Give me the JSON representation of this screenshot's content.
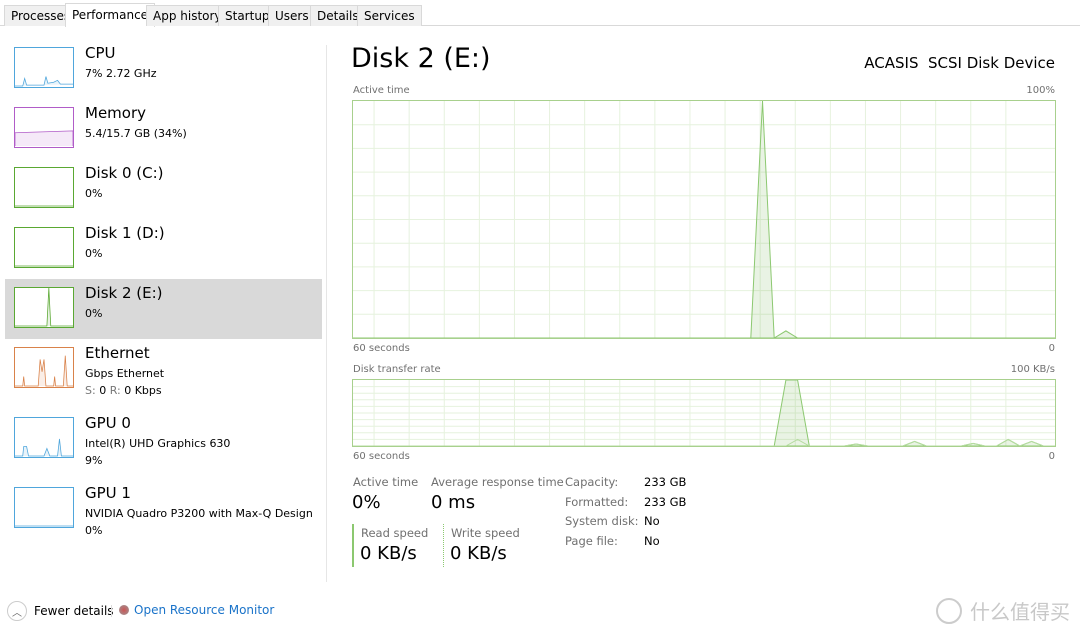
{
  "tabs": [
    "Processes",
    "Performance",
    "App history",
    "Startup",
    "Users",
    "Details",
    "Services"
  ],
  "active_tab": "Performance",
  "sidebar": [
    {
      "title": "CPU",
      "lines": [
        "7%  2.72 GHz"
      ],
      "color": "#4fa6dc"
    },
    {
      "title": "Memory",
      "lines": [
        "5.4/15.7 GB (34%)"
      ],
      "color": "#b15cc8"
    },
    {
      "title": "Disk 0 (C:)",
      "lines": [
        "0%"
      ],
      "color": "#5aa832"
    },
    {
      "title": "Disk 1 (D:)",
      "lines": [
        "0%"
      ],
      "color": "#5aa832"
    },
    {
      "title": "Disk 2 (E:)",
      "lines": [
        "0%"
      ],
      "color": "#5aa832",
      "selected": true
    },
    {
      "title": "Ethernet",
      "lines": [
        "Gbps Ethernet"
      ],
      "send_label": "S:",
      "send": "0",
      "recv_label": "R:",
      "recv": "0 Kbps",
      "color": "#d9824a"
    },
    {
      "title": "GPU 0",
      "lines": [
        "Intel(R) UHD Graphics 630",
        "9%"
      ],
      "color": "#4fa6dc"
    },
    {
      "title": "GPU 1",
      "lines": [
        "NVIDIA Quadro P3200 with Max-Q Design",
        "0%"
      ],
      "color": "#4fa6dc"
    }
  ],
  "main": {
    "title": "Disk 2 (E:)",
    "device": "ACASIS  SCSI Disk Device",
    "stats": {
      "active_label": "Active time",
      "active": "0%",
      "resp_label": "Average response time",
      "resp": "0 ms",
      "read_label": "Read speed",
      "read": "0 KB/s",
      "write_label": "Write speed",
      "write": "0 KB/s"
    },
    "props": [
      [
        "Capacity:",
        "233 GB"
      ],
      [
        "Formatted:",
        "233 GB"
      ],
      [
        "System disk:",
        "No"
      ],
      [
        "Page file:",
        "No"
      ]
    ]
  },
  "chart_data": [
    {
      "type": "area",
      "title": "Active time",
      "ymax_label": "100%",
      "ylim": [
        0,
        100
      ],
      "xlabel_left": "60 seconds",
      "xlabel_right": "0",
      "x_range_seconds": [
        60,
        0
      ],
      "grid": true,
      "color": "#5aa832",
      "values": [
        0,
        0,
        0,
        0,
        0,
        0,
        0,
        0,
        0,
        0,
        0,
        0,
        0,
        0,
        0,
        0,
        0,
        0,
        0,
        0,
        0,
        0,
        0,
        0,
        0,
        0,
        0,
        0,
        0,
        0,
        0,
        0,
        0,
        0,
        0,
        100,
        0,
        3,
        0,
        0,
        0,
        0,
        0,
        0,
        0,
        0,
        0,
        0,
        0,
        0,
        0,
        0,
        0,
        0,
        0,
        0,
        0,
        0,
        0,
        0,
        0
      ]
    },
    {
      "type": "area",
      "title": "Disk transfer rate",
      "ymax_label": "100 KB/s",
      "ylim": [
        0,
        100
      ],
      "xlabel_left": "60 seconds",
      "xlabel_right": "0",
      "x_range_seconds": [
        60,
        0
      ],
      "grid": true,
      "color": "#5aa832",
      "values": [
        0,
        0,
        0,
        0,
        0,
        0,
        0,
        0,
        0,
        0,
        0,
        0,
        0,
        0,
        0,
        0,
        0,
        0,
        0,
        0,
        0,
        0,
        0,
        0,
        0,
        0,
        0,
        0,
        0,
        0,
        0,
        0,
        0,
        0,
        0,
        0,
        0,
        150,
        140,
        0,
        0,
        0,
        0,
        3,
        0,
        0,
        0,
        0,
        7,
        0,
        0,
        0,
        0,
        4,
        0,
        0,
        10,
        0,
        7,
        0,
        0
      ],
      "secondary_values": [
        0,
        0,
        0,
        0,
        0,
        0,
        0,
        0,
        0,
        0,
        0,
        0,
        0,
        0,
        0,
        0,
        0,
        0,
        0,
        0,
        0,
        0,
        0,
        0,
        0,
        0,
        0,
        0,
        0,
        0,
        0,
        0,
        0,
        0,
        0,
        0,
        0,
        0,
        10,
        0,
        0,
        0,
        0,
        3,
        0,
        0,
        0,
        0,
        7,
        0,
        0,
        0,
        0,
        4,
        0,
        0,
        10,
        0,
        7,
        0,
        0
      ]
    }
  ],
  "footer": {
    "fewer": "Fewer details",
    "monitor": "Open Resource Monitor"
  },
  "watermark": "什么值得买"
}
